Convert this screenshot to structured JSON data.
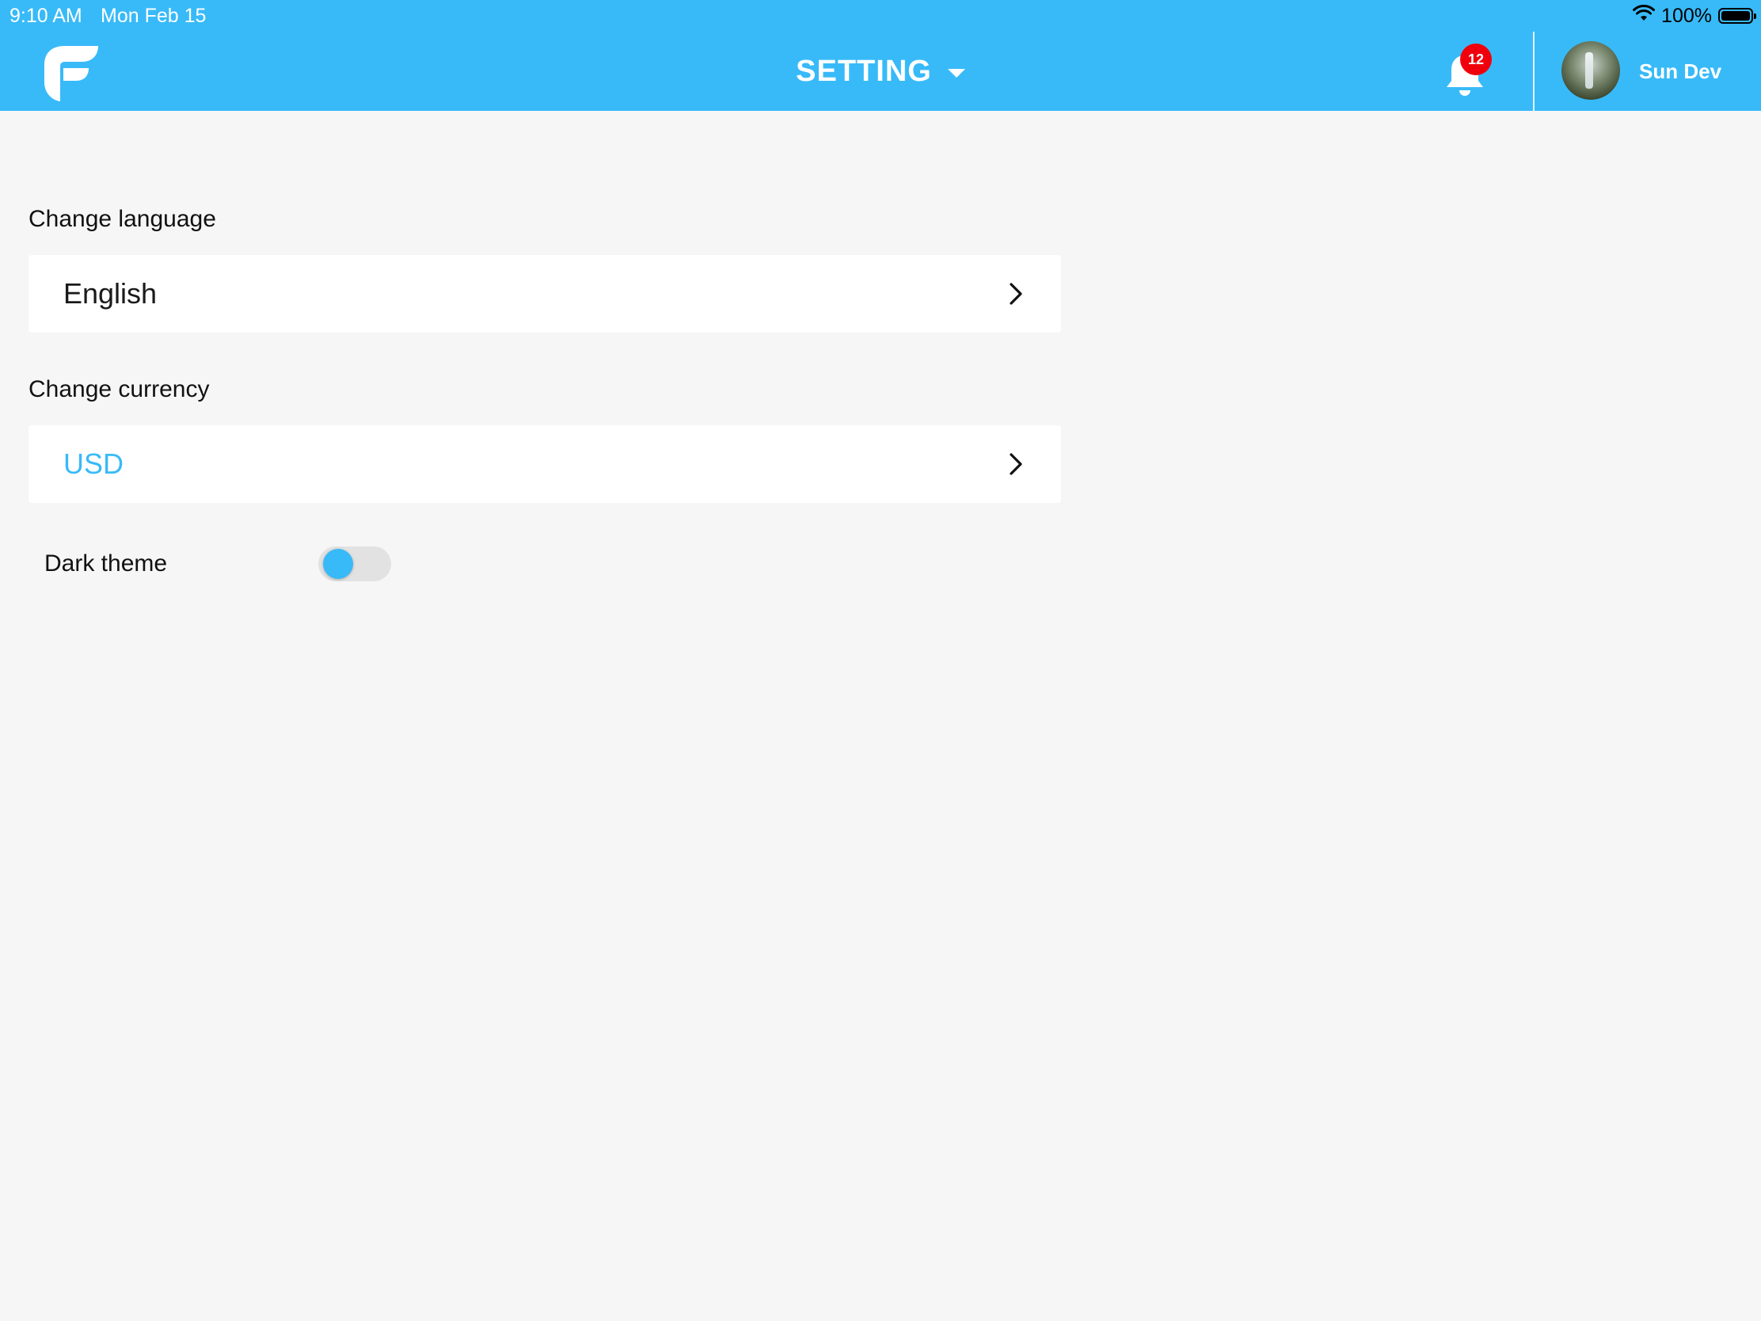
{
  "status_bar": {
    "time": "9:10 AM",
    "date": "Mon Feb 15",
    "battery": "100%",
    "wifi_icon": "wifi-icon",
    "battery_icon": "battery-icon"
  },
  "header": {
    "title": "SETTING",
    "notification_count": "12",
    "user_name": "Sun Dev",
    "logo_icon": "app-logo",
    "bell_icon": "bell-icon",
    "accent_color": "#38baf8",
    "badge_color": "#f0000c"
  },
  "settings": {
    "language": {
      "label": "Change language",
      "value": "English"
    },
    "currency": {
      "label": "Change currency",
      "value": "USD",
      "value_color": "#38baf8"
    },
    "dark_theme": {
      "label": "Dark theme",
      "enabled": false
    }
  }
}
